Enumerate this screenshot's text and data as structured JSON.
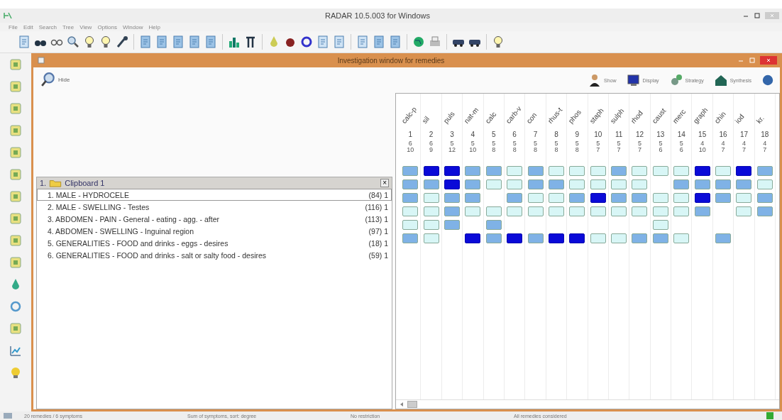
{
  "window": {
    "title": "RADAR 10.5.003 for Windows"
  },
  "menu": [
    "File",
    "Edit",
    "Search",
    "Tree",
    "View",
    "Options",
    "Window",
    "Help"
  ],
  "inner_window": {
    "title": "Investigation window for remedies"
  },
  "left_header": {
    "label": "Hide"
  },
  "header_buttons": [
    "Show",
    "Display",
    "Strategy",
    "Synthesis"
  ],
  "clipboard": {
    "title": "1.",
    "name": "Clipboard 1",
    "close": "×",
    "rubrics": [
      {
        "text": "1. MALE - HYDROCELE",
        "count": "(84) 1",
        "selected": true,
        "cells": [
          {
            "kind": "mid"
          },
          {
            "kind": "high"
          },
          {
            "kind": "high"
          },
          {
            "kind": "mid"
          },
          {
            "kind": "mid"
          },
          {
            "kind": "low"
          },
          {
            "kind": "mid"
          },
          {
            "kind": "low"
          },
          {
            "kind": "low"
          },
          {
            "kind": "low"
          },
          {
            "kind": "mid"
          },
          {
            "kind": "low"
          },
          {
            "kind": "low"
          },
          {
            "kind": "low"
          },
          {
            "kind": "high"
          },
          {
            "kind": "low"
          },
          {
            "kind": "high"
          },
          {
            "kind": "mid"
          }
        ]
      },
      {
        "text": "2. MALE - SWELLING - Testes",
        "count": "(116) 1",
        "selected": false,
        "cells": [
          {
            "kind": "mid"
          },
          {
            "kind": "mid"
          },
          {
            "kind": "high"
          },
          {
            "kind": "mid"
          },
          {
            "kind": "low"
          },
          {
            "kind": "low"
          },
          {
            "kind": "mid"
          },
          {
            "kind": "mid"
          },
          {
            "kind": "low"
          },
          {
            "kind": "low"
          },
          {
            "kind": "low"
          },
          {
            "kind": "low"
          },
          {
            "kind": "none"
          },
          {
            "kind": "mid"
          },
          {
            "kind": "mid"
          },
          {
            "kind": "mid"
          },
          {
            "kind": "mid"
          },
          {
            "kind": "low"
          }
        ]
      },
      {
        "text": "3. ABDOMEN - PAIN - General - eating - agg. - after",
        "count": "(113) 1",
        "selected": false,
        "cells": [
          {
            "kind": "mid"
          },
          {
            "kind": "low"
          },
          {
            "kind": "mid"
          },
          {
            "kind": "mid"
          },
          {
            "kind": "none"
          },
          {
            "kind": "mid"
          },
          {
            "kind": "low"
          },
          {
            "kind": "low"
          },
          {
            "kind": "mid"
          },
          {
            "kind": "high"
          },
          {
            "kind": "mid"
          },
          {
            "kind": "mid"
          },
          {
            "kind": "low"
          },
          {
            "kind": "low"
          },
          {
            "kind": "high"
          },
          {
            "kind": "mid"
          },
          {
            "kind": "low"
          },
          {
            "kind": "mid"
          }
        ]
      },
      {
        "text": "4. ABDOMEN - SWELLING - Inguinal region",
        "count": "(97) 1",
        "selected": false,
        "cells": [
          {
            "kind": "low"
          },
          {
            "kind": "low"
          },
          {
            "kind": "mid"
          },
          {
            "kind": "low"
          },
          {
            "kind": "low"
          },
          {
            "kind": "low"
          },
          {
            "kind": "low"
          },
          {
            "kind": "low"
          },
          {
            "kind": "low"
          },
          {
            "kind": "low"
          },
          {
            "kind": "low"
          },
          {
            "kind": "low"
          },
          {
            "kind": "low"
          },
          {
            "kind": "low"
          },
          {
            "kind": "mid"
          },
          {
            "kind": "none"
          },
          {
            "kind": "low"
          },
          {
            "kind": "mid"
          }
        ]
      },
      {
        "text": "5. GENERALITIES - FOOD and drinks - eggs - desires",
        "count": "(18) 1",
        "selected": false,
        "cells": [
          {
            "kind": "low"
          },
          {
            "kind": "low"
          },
          {
            "kind": "mid"
          },
          {
            "kind": "none"
          },
          {
            "kind": "mid"
          },
          {
            "kind": "none"
          },
          {
            "kind": "none"
          },
          {
            "kind": "none"
          },
          {
            "kind": "none"
          },
          {
            "kind": "none"
          },
          {
            "kind": "none"
          },
          {
            "kind": "none"
          },
          {
            "kind": "low"
          },
          {
            "kind": "none"
          },
          {
            "kind": "none"
          },
          {
            "kind": "none"
          },
          {
            "kind": "none"
          },
          {
            "kind": "none"
          }
        ]
      },
      {
        "text": "6. GENERALITIES - FOOD and drinks - salt or salty food - desires",
        "count": "(59) 1",
        "selected": false,
        "cells": [
          {
            "kind": "mid"
          },
          {
            "kind": "low"
          },
          {
            "kind": "none"
          },
          {
            "kind": "high"
          },
          {
            "kind": "mid"
          },
          {
            "kind": "high"
          },
          {
            "kind": "mid"
          },
          {
            "kind": "high"
          },
          {
            "kind": "high"
          },
          {
            "kind": "low"
          },
          {
            "kind": "low"
          },
          {
            "kind": "mid"
          },
          {
            "kind": "mid"
          },
          {
            "kind": "low"
          },
          {
            "kind": "none"
          },
          {
            "kind": "mid"
          },
          {
            "kind": "none"
          },
          {
            "kind": "none"
          }
        ]
      }
    ]
  },
  "remedies": [
    {
      "name": "calc-p",
      "number": "1",
      "symptoms": "6",
      "degree": "10"
    },
    {
      "name": "sil",
      "number": "2",
      "symptoms": "6",
      "degree": "9"
    },
    {
      "name": "puls",
      "number": "3",
      "symptoms": "5",
      "degree": "12"
    },
    {
      "name": "nat-m",
      "number": "4",
      "symptoms": "5",
      "degree": "10"
    },
    {
      "name": "calc",
      "number": "5",
      "symptoms": "5",
      "degree": "8"
    },
    {
      "name": "carb-v",
      "number": "6",
      "symptoms": "5",
      "degree": "8"
    },
    {
      "name": "con",
      "number": "7",
      "symptoms": "5",
      "degree": "8"
    },
    {
      "name": "rhus-t",
      "number": "8",
      "symptoms": "5",
      "degree": "8"
    },
    {
      "name": "phos",
      "number": "9",
      "symptoms": "5",
      "degree": "8"
    },
    {
      "name": "staph",
      "number": "10",
      "symptoms": "5",
      "degree": "7"
    },
    {
      "name": "sulph",
      "number": "11",
      "symptoms": "5",
      "degree": "7"
    },
    {
      "name": "rhod",
      "number": "12",
      "symptoms": "5",
      "degree": "7"
    },
    {
      "name": "caust",
      "number": "13",
      "symptoms": "5",
      "degree": "6"
    },
    {
      "name": "merc",
      "number": "14",
      "symptoms": "5",
      "degree": "6"
    },
    {
      "name": "graph",
      "number": "15",
      "symptoms": "4",
      "degree": "10"
    },
    {
      "name": "chin",
      "number": "16",
      "symptoms": "4",
      "degree": "7"
    },
    {
      "name": "iod",
      "number": "17",
      "symptoms": "4",
      "degree": "7"
    },
    {
      "name": "kr.",
      "number": "18",
      "symptoms": "4",
      "degree": "7"
    }
  ],
  "status_bar": [
    "20 remedies / 6 symptoms",
    "Sum of symptoms, sort: degree",
    "No restriction",
    "All remedies considered"
  ]
}
